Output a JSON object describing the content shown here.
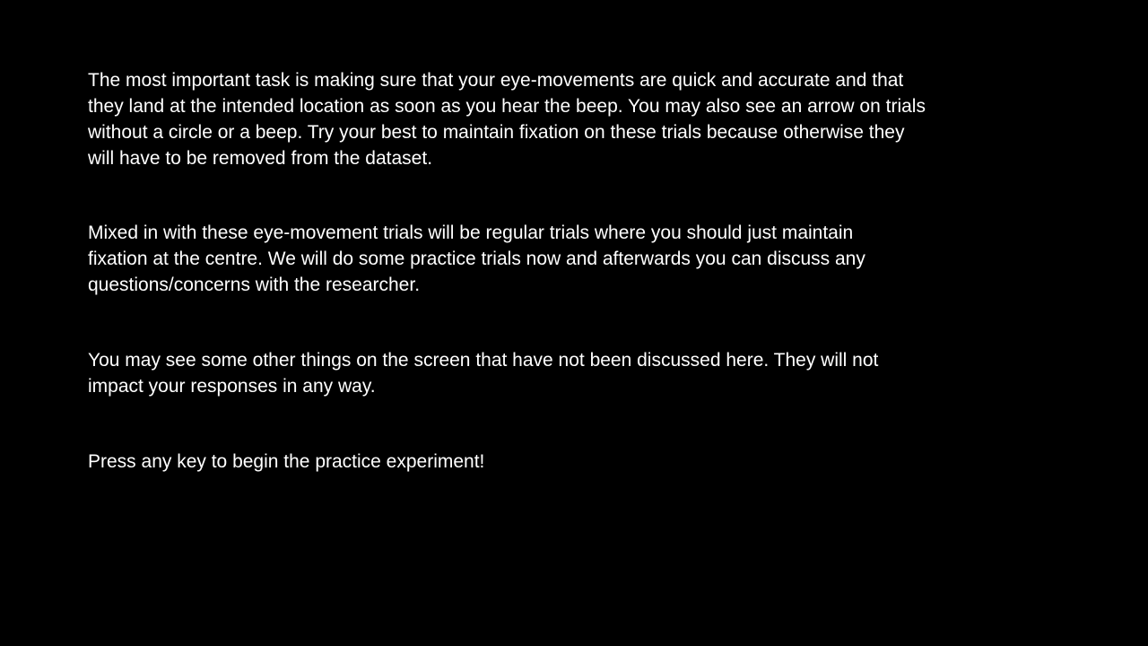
{
  "instructions": {
    "paragraphs": [
      {
        "lines": [
          "The most important task is making sure that your eye-movements are quick and accurate and that",
          "they land at the intended location as soon as you hear the beep. You may also see an arrow on trials",
          "without a circle or a beep. Try your best to maintain fixation on these trials because otherwise they",
          "will have to be removed from the dataset."
        ]
      },
      {
        "lines": [
          "Mixed in with these eye-movement trials will be regular trials where you should just maintain",
          "fixation at the centre. We will do some practice trials now and afterwards you can discuss any",
          "questions/concerns with the researcher."
        ]
      },
      {
        "lines": [
          "You may see some other things on the screen that have not been discussed here. They will not",
          "impact your responses in any way."
        ]
      },
      {
        "lines": [
          "Press any key to begin the practice experiment!"
        ]
      }
    ]
  }
}
